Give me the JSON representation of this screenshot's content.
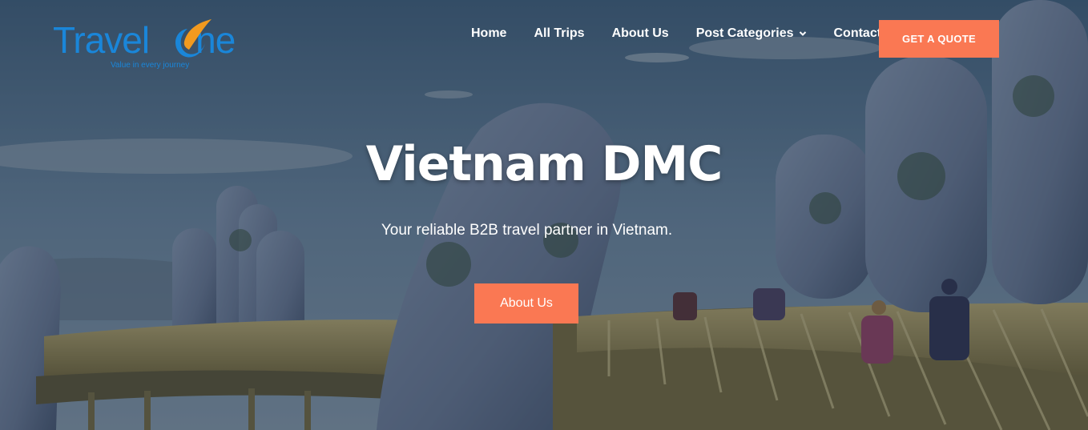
{
  "brand": {
    "name_part1": "Travel",
    "name_part2": "ne",
    "tagline": "Value in every journey",
    "logo_color": "#1a86d9",
    "logo_accent": "#f29a1f"
  },
  "nav": {
    "items": [
      {
        "label": "Home"
      },
      {
        "label": "All Trips"
      },
      {
        "label": "About Us"
      },
      {
        "label": "Post Categories",
        "has_dropdown": true
      },
      {
        "label": "Contact"
      }
    ],
    "cta_label": "GET A QUOTE",
    "accent_color": "#fa7853"
  },
  "hero": {
    "title": "Vietnam DMC",
    "subtitle": "Your reliable B2B travel partner in Vietnam.",
    "button_label": "About Us",
    "background": "photo-golden-bridge-hands"
  }
}
